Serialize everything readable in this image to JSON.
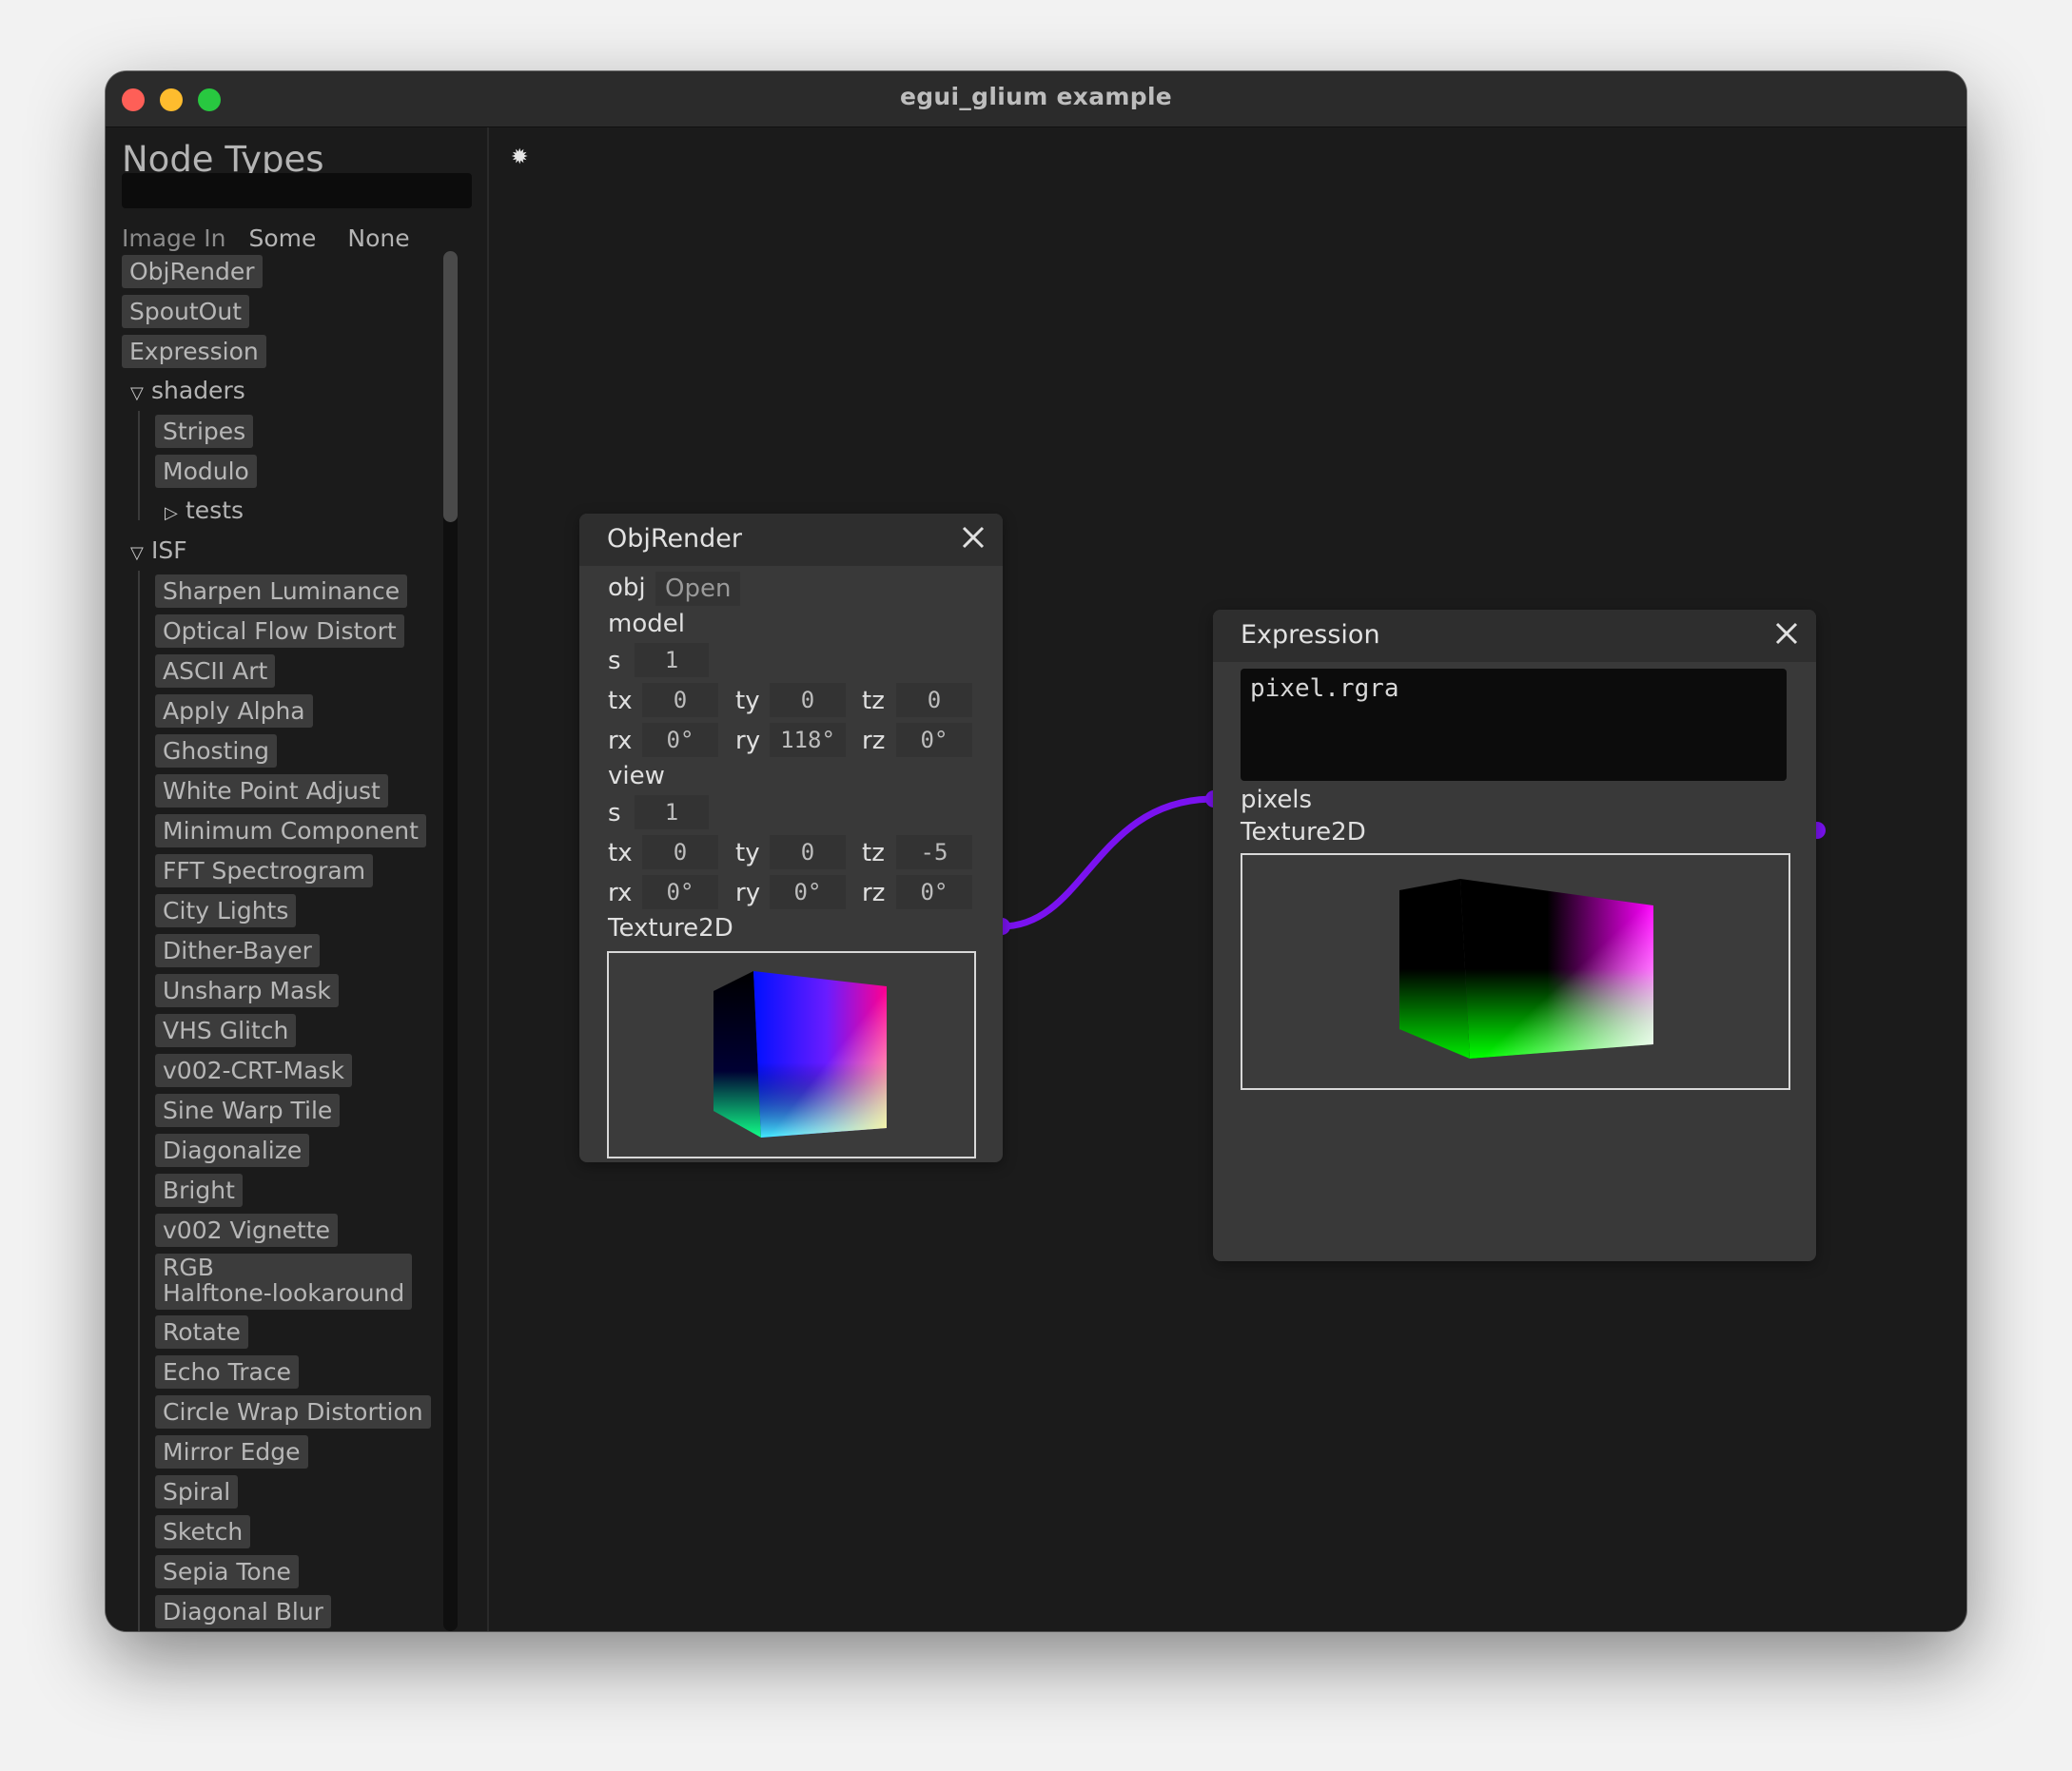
{
  "window": {
    "title": "egui_glium example"
  },
  "sidebar": {
    "title": "Node Types",
    "search_value": "",
    "image_in": {
      "label": "Image In",
      "options": [
        "Some",
        "None"
      ]
    },
    "top_items": [
      "ObjRender",
      "SpoutOut",
      "Expression"
    ],
    "shaders": {
      "label": "shaders",
      "items": [
        "Stripes",
        "Modulo"
      ],
      "subfolder": "tests"
    },
    "isf": {
      "label": "ISF",
      "items": [
        "Sharpen Luminance",
        "Optical Flow Distort",
        "ASCII Art",
        "Apply Alpha",
        "Ghosting",
        "White Point Adjust",
        "Minimum Component",
        "FFT Spectrogram",
        "City Lights",
        "Dither-Bayer",
        "Unsharp Mask",
        "VHS Glitch",
        "v002-CRT-Mask",
        "Sine Warp Tile",
        "Diagonalize",
        "Bright",
        "v002 Vignette",
        "RGB",
        "Halftone-lookaround",
        "Rotate",
        "Echo Trace",
        "Circle Wrap Distortion",
        "Mirror Edge",
        "Spiral",
        "Sketch",
        "Sepia Tone",
        "Diagonal Blur"
      ]
    }
  },
  "canvas": {
    "icon": "sun-icon",
    "connection_color": "#7a12f0"
  },
  "objrender": {
    "title": "ObjRender",
    "obj_label": "obj",
    "open_label": "Open",
    "model_label": "model",
    "view_label": "view",
    "s_label": "s",
    "tx_label": "tx",
    "ty_label": "ty",
    "tz_label": "tz",
    "rx_label": "rx",
    "ry_label": "ry",
    "rz_label": "rz",
    "model": {
      "s": "1",
      "tx": "0",
      "ty": "0",
      "tz": "0",
      "rx": "0°",
      "ry": "118°",
      "rz": "0°"
    },
    "view": {
      "s": "1",
      "tx": "0",
      "ty": "0",
      "tz": "-5",
      "rx": "0°",
      "ry": "0°",
      "rz": "0°"
    },
    "output_label": "Texture2D"
  },
  "expression": {
    "title": "Expression",
    "code": "pixel.rgra",
    "input_label": "pixels",
    "output_label": "Texture2D"
  }
}
